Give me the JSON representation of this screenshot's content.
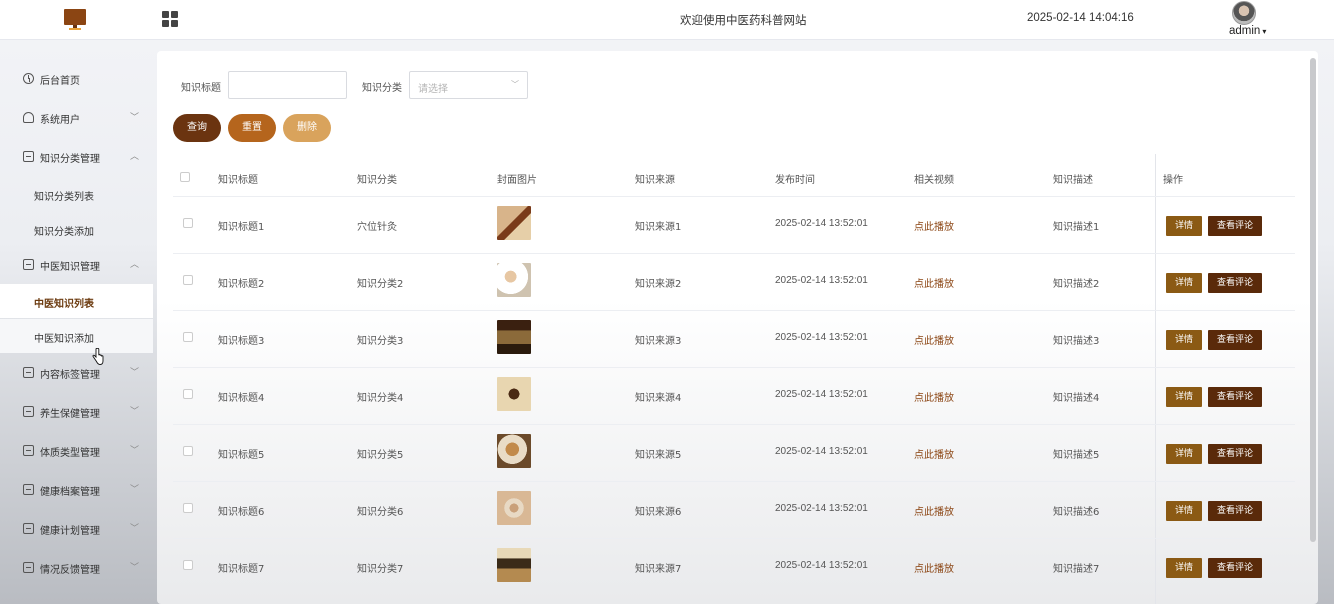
{
  "header": {
    "site_title": "欢迎使用中医药科普网站",
    "datetime": "2025-02-14 14:04:16",
    "username": "admin"
  },
  "sidebar": {
    "items": [
      {
        "label": "后台首页",
        "icon": "clock-icon"
      },
      {
        "label": "系统用户",
        "icon": "user-icon"
      },
      {
        "label": "知识分类管理",
        "icon": "card-icon"
      },
      {
        "label": "知识分类列表"
      },
      {
        "label": "知识分类添加"
      },
      {
        "label": "中医知识管理",
        "icon": "card-icon"
      },
      {
        "label": "中医知识列表"
      },
      {
        "label": "中医知识添加"
      },
      {
        "label": "内容标签管理",
        "icon": "card-icon"
      },
      {
        "label": "养生保健管理",
        "icon": "card-icon"
      },
      {
        "label": "体质类型管理",
        "icon": "card-icon"
      },
      {
        "label": "健康档案管理",
        "icon": "card-icon"
      },
      {
        "label": "健康计划管理",
        "icon": "card-icon"
      },
      {
        "label": "情况反馈管理",
        "icon": "card-icon"
      }
    ]
  },
  "filters": {
    "title_label": "知识标题",
    "title_value": "",
    "category_label": "知识分类",
    "category_placeholder": "请选择"
  },
  "buttons": {
    "query": "查询",
    "reset": "重置",
    "delete": "删除"
  },
  "table": {
    "headers": [
      "知识标题",
      "知识分类",
      "封面图片",
      "知识来源",
      "发布时间",
      "相关视频",
      "知识描述",
      "操作"
    ],
    "rows": [
      {
        "title": "知识标题1",
        "category": "穴位针灸",
        "source": "知识来源1",
        "time": "2025-02-14 13:52:01",
        "video": "点此播放",
        "desc": "知识描述1"
      },
      {
        "title": "知识标题2",
        "category": "知识分类2",
        "source": "知识来源2",
        "time": "2025-02-14 13:52:01",
        "video": "点此播放",
        "desc": "知识描述2"
      },
      {
        "title": "知识标题3",
        "category": "知识分类3",
        "source": "知识来源3",
        "time": "2025-02-14 13:52:01",
        "video": "点此播放",
        "desc": "知识描述3"
      },
      {
        "title": "知识标题4",
        "category": "知识分类4",
        "source": "知识来源4",
        "time": "2025-02-14 13:52:01",
        "video": "点此播放",
        "desc": "知识描述4"
      },
      {
        "title": "知识标题5",
        "category": "知识分类5",
        "source": "知识来源5",
        "time": "2025-02-14 13:52:01",
        "video": "点此播放",
        "desc": "知识描述5"
      },
      {
        "title": "知识标题6",
        "category": "知识分类6",
        "source": "知识来源6",
        "time": "2025-02-14 13:52:01",
        "video": "点此播放",
        "desc": "知识描述6"
      },
      {
        "title": "知识标题7",
        "category": "知识分类7",
        "source": "知识来源7",
        "time": "2025-02-14 13:52:01",
        "video": "点此播放",
        "desc": "知识描述7"
      }
    ],
    "action_detail": "详情",
    "action_review": "查看评论"
  },
  "colors": {
    "primary_dark": "#6b3410",
    "primary": "#b5651d",
    "primary_light": "#d9a35c",
    "link": "#8b4513"
  }
}
